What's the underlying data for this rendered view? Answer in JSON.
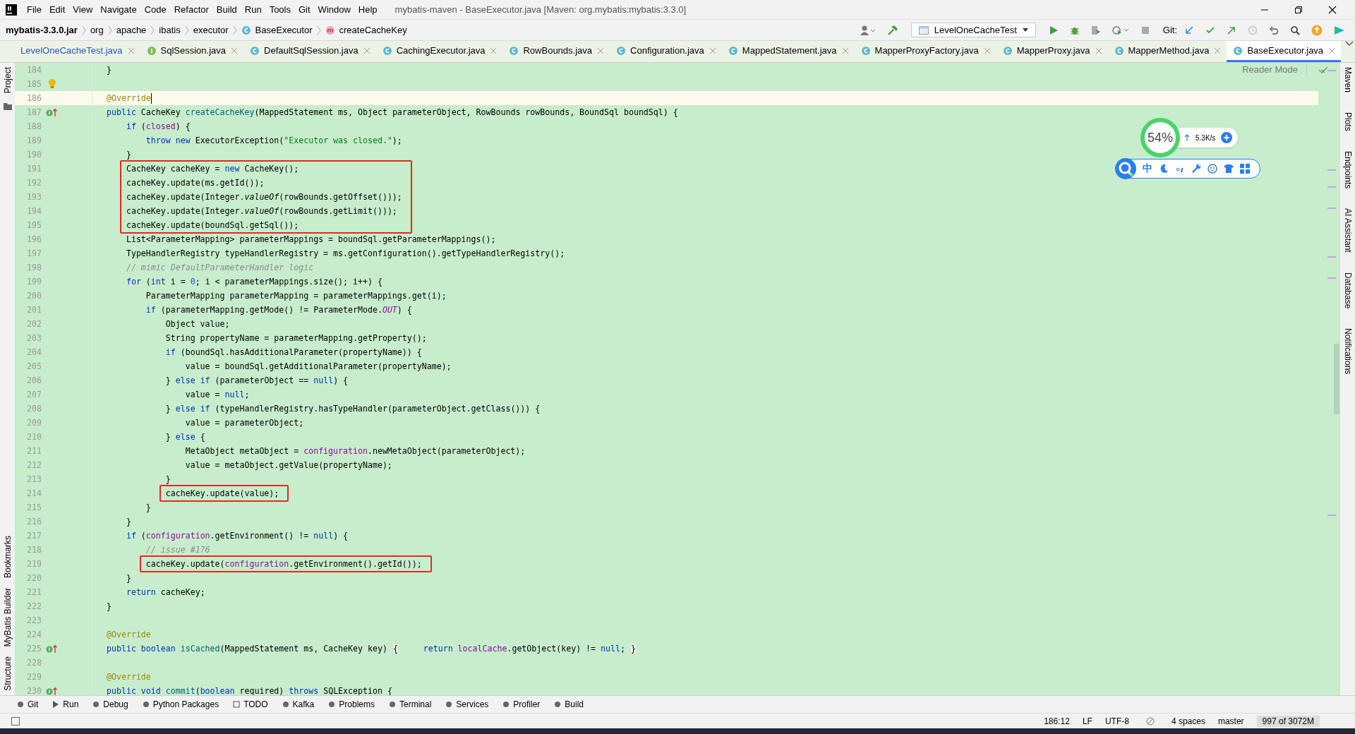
{
  "window": {
    "title": "mybatis-maven - BaseExecutor.java [Maven: org.mybatis:mybatis:3.3.0]"
  },
  "menu": [
    "File",
    "Edit",
    "View",
    "Navigate",
    "Code",
    "Refactor",
    "Build",
    "Run",
    "Tools",
    "Git",
    "Window",
    "Help"
  ],
  "breadcrumbs": [
    {
      "label": "mybatis-3.3.0.jar",
      "kind": "jar"
    },
    {
      "label": "org",
      "kind": "package"
    },
    {
      "label": "apache",
      "kind": "package"
    },
    {
      "label": "ibatis",
      "kind": "package"
    },
    {
      "label": "executor",
      "kind": "package"
    },
    {
      "label": "BaseExecutor",
      "kind": "class"
    },
    {
      "label": "createCacheKey",
      "kind": "method"
    }
  ],
  "run_config": {
    "label": "LevelOneCacheTest"
  },
  "git_label": "Git:",
  "tabs": [
    {
      "label": "LevelOneCacheTest.java",
      "kind": "test",
      "selected": false
    },
    {
      "label": "SqlSession.java",
      "kind": "interface",
      "selected": false
    },
    {
      "label": "DefaultSqlSession.java",
      "kind": "class",
      "selected": false
    },
    {
      "label": "CachingExecutor.java",
      "kind": "class",
      "selected": false
    },
    {
      "label": "RowBounds.java",
      "kind": "class",
      "selected": false
    },
    {
      "label": "Configuration.java",
      "kind": "class",
      "selected": false
    },
    {
      "label": "MappedStatement.java",
      "kind": "class",
      "selected": false
    },
    {
      "label": "MapperProxyFactory.java",
      "kind": "class",
      "selected": false
    },
    {
      "label": "MapperProxy.java",
      "kind": "class",
      "selected": false
    },
    {
      "label": "MapperMethod.java",
      "kind": "class",
      "selected": false
    },
    {
      "label": "BaseExecutor.java",
      "kind": "class",
      "selected": true
    }
  ],
  "left_tools": [
    "Project",
    "Bookmarks",
    "MyBatis Builder",
    "Structure"
  ],
  "right_tools": [
    "Maven",
    "Plots",
    "Endpoints",
    "AI Assistant",
    "Database",
    "Notifications"
  ],
  "reader_mode": "Reader Mode",
  "editor": {
    "lines": [
      {
        "number": "184",
        "kind": "code",
        "tokens": [
          {
            "kind": "plain",
            "text": "}"
          }
        ]
      },
      {
        "number": "185",
        "kind": "hint"
      },
      {
        "number": "186",
        "kind": "code",
        "current": true,
        "tokens": [
          {
            "kind": "annotation",
            "text": "@Override"
          }
        ]
      },
      {
        "number": "187",
        "kind": "override",
        "tokens": [
          {
            "kind": "keyword",
            "text": "public"
          },
          {
            "kind": "plain",
            "text": " CacheKey "
          },
          {
            "kind": "declaration",
            "text": "createCacheKey"
          },
          {
            "kind": "plain",
            "text": "(MappedStatement ms, Object parameterObject, RowBounds rowBounds, BoundSql boundSql) {"
          }
        ]
      },
      {
        "number": "188",
        "kind": "code",
        "tokens": [
          {
            "kind": "keyword",
            "text": "    if"
          },
          {
            "kind": "plain",
            "text": " ("
          },
          {
            "kind": "field",
            "text": "closed"
          },
          {
            "kind": "plain",
            "text": ") {"
          }
        ]
      },
      {
        "number": "189",
        "kind": "code",
        "tokens": [
          {
            "kind": "keyword",
            "text": "        throw new"
          },
          {
            "kind": "plain",
            "text": " ExecutorException("
          },
          {
            "kind": "string",
            "text": "\"Executor was closed.\""
          },
          {
            "kind": "plain",
            "text": ");"
          }
        ]
      },
      {
        "number": "190",
        "kind": "code",
        "tokens": [
          {
            "kind": "plain",
            "text": "    }"
          }
        ]
      },
      {
        "number": "191",
        "kind": "code",
        "boxed": true,
        "tokens": [
          {
            "kind": "plain",
            "text": "    CacheKey cacheKey = "
          },
          {
            "kind": "keyword",
            "text": "new"
          },
          {
            "kind": "plain",
            "text": " CacheKey();"
          }
        ]
      },
      {
        "number": "192",
        "kind": "code",
        "boxed": true,
        "tokens": [
          {
            "kind": "plain",
            "text": "    cacheKey.update(ms.getId());"
          }
        ]
      },
      {
        "number": "193",
        "kind": "code",
        "boxed": true,
        "tokens": [
          {
            "kind": "plain",
            "text": "    cacheKey.update(Integer."
          },
          {
            "kind": "static",
            "text": "valueOf"
          },
          {
            "kind": "plain",
            "text": "(rowBounds.getOffset()));"
          }
        ]
      },
      {
        "number": "194",
        "kind": "code",
        "boxed": true,
        "tokens": [
          {
            "kind": "plain",
            "text": "    cacheKey.update(Integer."
          },
          {
            "kind": "static",
            "text": "valueOf"
          },
          {
            "kind": "plain",
            "text": "(rowBounds.getLimit()));"
          }
        ]
      },
      {
        "number": "195",
        "kind": "code",
        "boxed": true,
        "tokens": [
          {
            "kind": "plain",
            "text": "    cacheKey.update(boundSql.getSql());"
          }
        ]
      },
      {
        "number": "196",
        "kind": "code",
        "tokens": [
          {
            "kind": "plain",
            "text": "    List<ParameterMapping> parameterMappings = boundSql.getParameterMappings();"
          }
        ]
      },
      {
        "number": "197",
        "kind": "code",
        "tokens": [
          {
            "kind": "plain",
            "text": "    TypeHandlerRegistry typeHandlerRegistry = ms.getConfiguration().getTypeHandlerRegistry();"
          }
        ]
      },
      {
        "number": "198",
        "kind": "code",
        "tokens": [
          {
            "kind": "comment",
            "text": "    // mimic DefaultParameterHandler logic"
          }
        ]
      },
      {
        "number": "199",
        "kind": "code",
        "tokens": [
          {
            "kind": "keyword",
            "text": "    for"
          },
          {
            "kind": "plain",
            "text": " ("
          },
          {
            "kind": "keyword",
            "text": "int"
          },
          {
            "kind": "plain",
            "text": " i = "
          },
          {
            "kind": "number",
            "text": "0"
          },
          {
            "kind": "plain",
            "text": "; i < parameterMappings.size(); i++) {"
          }
        ]
      },
      {
        "number": "200",
        "kind": "code",
        "tokens": [
          {
            "kind": "plain",
            "text": "        ParameterMapping parameterMapping = parameterMappings.get(i);"
          }
        ]
      },
      {
        "number": "201",
        "kind": "code",
        "tokens": [
          {
            "kind": "keyword",
            "text": "        if"
          },
          {
            "kind": "plain",
            "text": " (parameterMapping.getMode() != ParameterMode."
          },
          {
            "kind": "constant",
            "text": "OUT"
          },
          {
            "kind": "plain",
            "text": ") {"
          }
        ]
      },
      {
        "number": "202",
        "kind": "code",
        "tokens": [
          {
            "kind": "plain",
            "text": "            Object value;"
          }
        ]
      },
      {
        "number": "203",
        "kind": "code",
        "tokens": [
          {
            "kind": "plain",
            "text": "            String propertyName = parameterMapping.getProperty();"
          }
        ]
      },
      {
        "number": "204",
        "kind": "code",
        "tokens": [
          {
            "kind": "keyword",
            "text": "            if"
          },
          {
            "kind": "plain",
            "text": " (boundSql.hasAdditionalParameter(propertyName)) {"
          }
        ]
      },
      {
        "number": "205",
        "kind": "code",
        "tokens": [
          {
            "kind": "plain",
            "text": "                value = boundSql.getAdditionalParameter(propertyName);"
          }
        ]
      },
      {
        "number": "206",
        "kind": "code",
        "tokens": [
          {
            "kind": "plain",
            "text": "            } "
          },
          {
            "kind": "keyword",
            "text": "else if"
          },
          {
            "kind": "plain",
            "text": " (parameterObject == "
          },
          {
            "kind": "keyword",
            "text": "null"
          },
          {
            "kind": "plain",
            "text": ") {"
          }
        ]
      },
      {
        "number": "207",
        "kind": "code",
        "tokens": [
          {
            "kind": "plain",
            "text": "                value = "
          },
          {
            "kind": "keyword",
            "text": "null"
          },
          {
            "kind": "plain",
            "text": ";"
          }
        ]
      },
      {
        "number": "208",
        "kind": "code",
        "tokens": [
          {
            "kind": "plain",
            "text": "            } "
          },
          {
            "kind": "keyword",
            "text": "else if"
          },
          {
            "kind": "plain",
            "text": " (typeHandlerRegistry.hasTypeHandler(parameterObject.getClass())) {"
          }
        ]
      },
      {
        "number": "209",
        "kind": "code",
        "tokens": [
          {
            "kind": "plain",
            "text": "                value = parameterObject;"
          }
        ]
      },
      {
        "number": "210",
        "kind": "code",
        "tokens": [
          {
            "kind": "plain",
            "text": "            } "
          },
          {
            "kind": "keyword",
            "text": "else"
          },
          {
            "kind": "plain",
            "text": " {"
          }
        ]
      },
      {
        "number": "211",
        "kind": "code",
        "tokens": [
          {
            "kind": "plain",
            "text": "                MetaObject metaObject = "
          },
          {
            "kind": "field",
            "text": "configuration"
          },
          {
            "kind": "plain",
            "text": ".newMetaObject(parameterObject);"
          }
        ]
      },
      {
        "number": "212",
        "kind": "code",
        "tokens": [
          {
            "kind": "plain",
            "text": "                value = metaObject.getValue(propertyName);"
          }
        ]
      },
      {
        "number": "213",
        "kind": "code",
        "tokens": [
          {
            "kind": "plain",
            "text": "            }"
          }
        ]
      },
      {
        "number": "214",
        "kind": "code",
        "boxed": true,
        "tokens": [
          {
            "kind": "plain",
            "text": "            cacheKey.update(value);"
          }
        ]
      },
      {
        "number": "215",
        "kind": "code",
        "tokens": [
          {
            "kind": "plain",
            "text": "        }"
          }
        ]
      },
      {
        "number": "216",
        "kind": "code",
        "tokens": [
          {
            "kind": "plain",
            "text": "    }"
          }
        ]
      },
      {
        "number": "217",
        "kind": "code",
        "tokens": [
          {
            "kind": "keyword",
            "text": "    if"
          },
          {
            "kind": "plain",
            "text": " ("
          },
          {
            "kind": "field",
            "text": "configuration"
          },
          {
            "kind": "plain",
            "text": ".getEnvironment() != "
          },
          {
            "kind": "keyword",
            "text": "null"
          },
          {
            "kind": "plain",
            "text": ") {"
          }
        ]
      },
      {
        "number": "218",
        "kind": "code",
        "tokens": [
          {
            "kind": "comment",
            "text": "        // issue #176"
          }
        ]
      },
      {
        "number": "219",
        "kind": "code",
        "boxed": true,
        "tokens": [
          {
            "kind": "plain",
            "text": "        cacheKey.update("
          },
          {
            "kind": "field",
            "text": "configuration"
          },
          {
            "kind": "plain",
            "text": ".getEnvironment().getId());"
          }
        ]
      },
      {
        "number": "220",
        "kind": "code",
        "tokens": [
          {
            "kind": "plain",
            "text": "    }"
          }
        ]
      },
      {
        "number": "221",
        "kind": "code",
        "tokens": [
          {
            "kind": "keyword",
            "text": "    return"
          },
          {
            "kind": "plain",
            "text": " cacheKey;"
          }
        ]
      },
      {
        "number": "222",
        "kind": "code",
        "tokens": [
          {
            "kind": "plain",
            "text": "}"
          }
        ]
      },
      {
        "number": "223",
        "kind": "code"
      },
      {
        "number": "224",
        "kind": "code",
        "tokens": [
          {
            "kind": "annotation",
            "text": "@Override"
          }
        ]
      },
      {
        "number": "225",
        "kind": "override",
        "tokens": [
          {
            "kind": "keyword",
            "text": "public boolean"
          },
          {
            "kind": "declaration",
            "text": " isCached"
          },
          {
            "kind": "plain",
            "text": "(MappedStatement ms, CacheKey key) "
          },
          {
            "kind": "fold",
            "text": "{"
          },
          {
            "kind": "keyword",
            "text": "     return"
          },
          {
            "kind": "field",
            "text": " localCache"
          },
          {
            "kind": "plain",
            "text": ".getObject(key) != "
          },
          {
            "kind": "keyword",
            "text": "null"
          },
          {
            "kind": "plain",
            "text": "; "
          },
          {
            "kind": "fold",
            "text": "}"
          }
        ]
      },
      {
        "number": "228",
        "kind": "code"
      },
      {
        "number": "229",
        "kind": "code",
        "tokens": [
          {
            "kind": "annotation",
            "text": "@Override"
          }
        ]
      },
      {
        "number": "230",
        "kind": "override",
        "tokens": [
          {
            "kind": "keyword",
            "text": "public void"
          },
          {
            "kind": "declaration",
            "text": " commit"
          },
          {
            "kind": "plain",
            "text": "("
          },
          {
            "kind": "keyword",
            "text": "boolean"
          },
          {
            "kind": "plain",
            "text": " required) "
          },
          {
            "kind": "keyword",
            "text": "throws"
          },
          {
            "kind": "plain",
            "text": " SQLException {"
          }
        ]
      }
    ]
  },
  "monitor": {
    "percent": "54%",
    "speed": "5.3K/s"
  },
  "ime": {
    "mode": "中"
  },
  "tool_windows": [
    "Git",
    "Run",
    "Debug",
    "Python Packages",
    "TODO",
    "Kafka",
    "Problems",
    "Terminal",
    "Services",
    "Profiler",
    "Build"
  ],
  "status": {
    "position": "186:12",
    "line_ending": "LF",
    "encoding": "UTF-8",
    "indent": "4 spaces",
    "branch": "master",
    "memory": "997 of 3072M"
  }
}
